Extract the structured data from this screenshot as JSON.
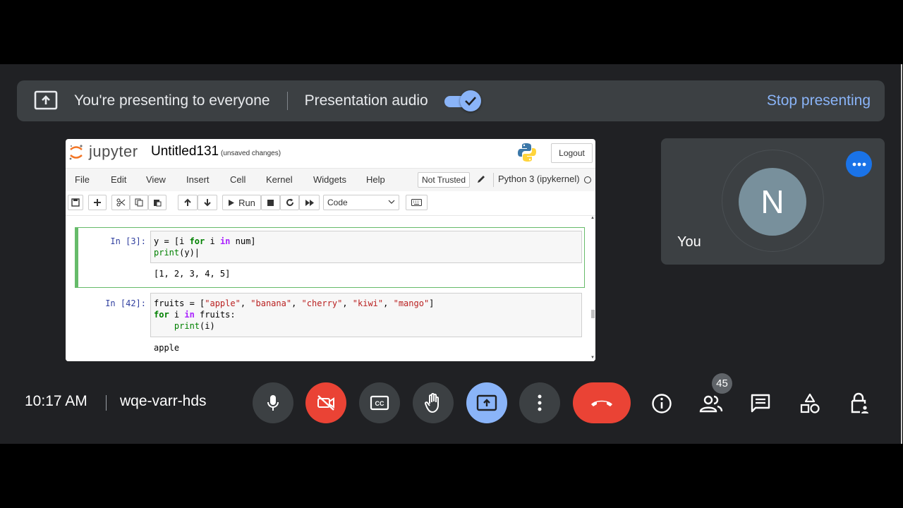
{
  "banner": {
    "message": "You're presenting to everyone",
    "audio_label": "Presentation audio",
    "audio_enabled": true,
    "stop_label": "Stop presenting"
  },
  "jupyter": {
    "logo_text": "jupyter",
    "notebook_title": "Untitled131",
    "save_status": "(unsaved changes)",
    "logout_label": "Logout",
    "menu": [
      "File",
      "Edit",
      "View",
      "Insert",
      "Cell",
      "Kernel",
      "Widgets",
      "Help"
    ],
    "trust_label": "Not Trusted",
    "kernel_name": "Python 3 (ipykernel)",
    "toolbar": {
      "run_label": "Run",
      "cell_type": "Code"
    },
    "cells": [
      {
        "prompt": "In [3]:",
        "code_lines": [
          "y = [i for i in num]",
          "print(y)"
        ],
        "output": "[1, 2, 3, 4, 5]"
      },
      {
        "prompt": "In [42]:",
        "code_lines": [
          "fruits = [\"apple\", \"banana\", \"cherry\", \"kiwi\", \"mango\"]",
          "for i in fruits:",
          "    print(i)"
        ],
        "output": "apple"
      }
    ]
  },
  "participant": {
    "initial": "N",
    "name": "You"
  },
  "bottom_bar": {
    "time": "10:17 AM",
    "meeting_code": "wqe-varr-hds",
    "participant_count": "45"
  },
  "colors": {
    "background": "#202124",
    "panel": "#3c4043",
    "accent": "#8ab4f8",
    "danger": "#ea4335",
    "avatar": "#78909c"
  }
}
